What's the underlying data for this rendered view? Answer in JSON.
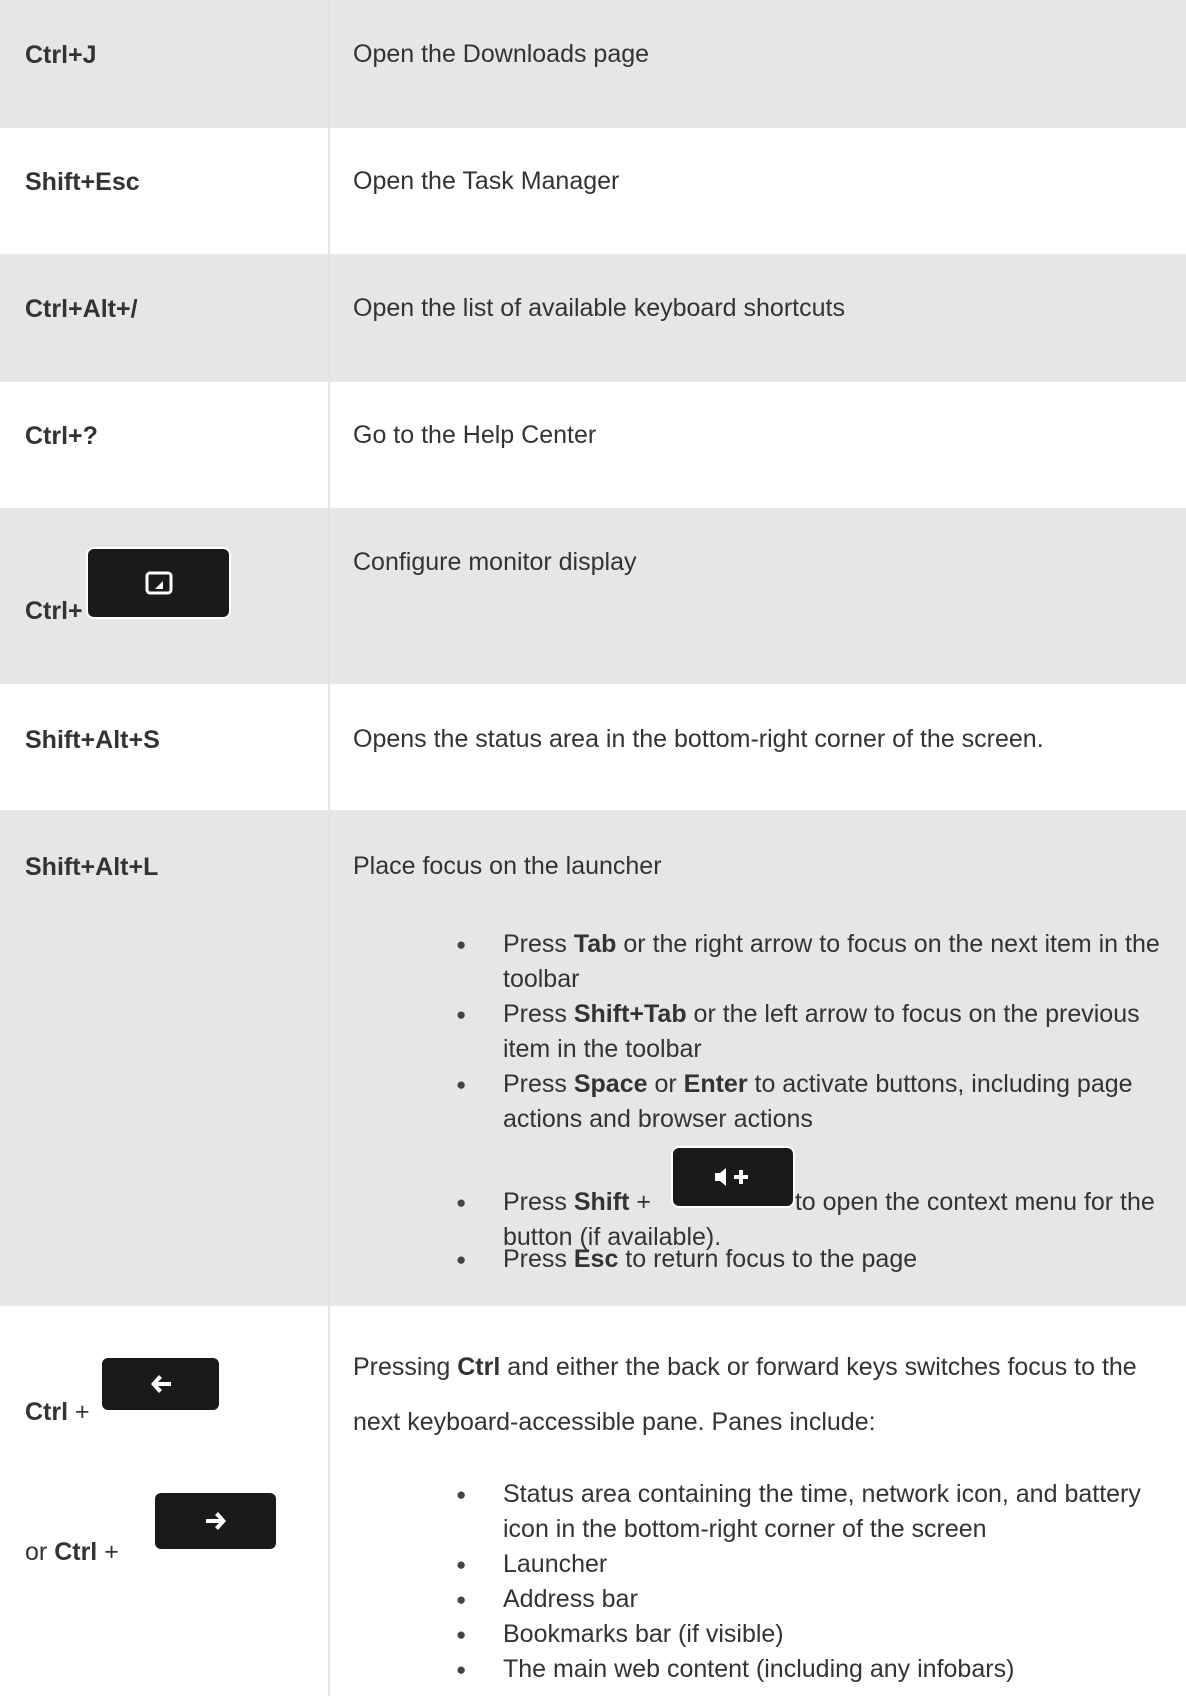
{
  "rows": [
    {
      "key": "Ctrl+J",
      "desc": "Open the Downloads page"
    },
    {
      "key": "Shift+Esc",
      "desc": "Open the Task Manager"
    },
    {
      "key": "Ctrl+Alt+/",
      "desc": "Open the list of available keyboard shortcuts"
    },
    {
      "key": "Ctrl+?",
      "desc": "Go to the Help Center"
    },
    {
      "key_prefix": "Ctrl+",
      "key_icon": "switch-window-key-icon",
      "desc": "Configure monitor display"
    },
    {
      "key": "Shift+Alt+S",
      "desc": "Opens the status area in the bottom-right corner of the screen."
    },
    {
      "key": "Shift+Alt+L",
      "desc": "Place focus on the launcher",
      "bullets": [
        {
          "pre": "Press ",
          "bold": "Tab",
          "post": " or the right arrow to focus on the next item in the toolbar"
        },
        {
          "pre": "Press ",
          "bold": "Shift+Tab",
          "post": " or the left arrow to focus on the previous item in the toolbar"
        },
        {
          "pre": "Press ",
          "bold": "Space",
          "mid": " or ",
          "bold2": "Enter",
          "post": " to activate buttons, including page actions and browser actions"
        },
        {
          "pre": "Press ",
          "bold": "Shift",
          "mid": " + ",
          "icon": "volume-up-key-icon",
          "post": " to open the context menu for the button (if available)."
        },
        {
          "pre": "Press ",
          "bold": "Esc",
          "post": " to return focus to the page"
        }
      ]
    },
    {
      "key_line1_bold": "Ctrl",
      "key_line1_plain": " +",
      "key_icon1": "back-arrow-key-icon",
      "key_line2_plain": "or ",
      "key_line2_bold": "Ctrl",
      "key_line2_plain2": " +",
      "key_icon2": "forward-arrow-key-icon",
      "desc_pre": "Pressing ",
      "desc_bold": "Ctrl",
      "desc_post": " and either the back or forward keys switches focus to the next keyboard-accessible pane. Panes include:",
      "bullets": [
        "Status area containing the time, network icon, and battery icon in the bottom-right corner of the screen",
        "Launcher",
        "Address bar",
        "Bookmarks bar (if visible)",
        "The main web content (including any infobars)"
      ]
    }
  ],
  "bullet_glyph": "●",
  "colors": {
    "row_gray": "#e6e6e6",
    "row_white": "#ffffff",
    "text": "#333333",
    "key_cap": "#1a1a1a"
  }
}
